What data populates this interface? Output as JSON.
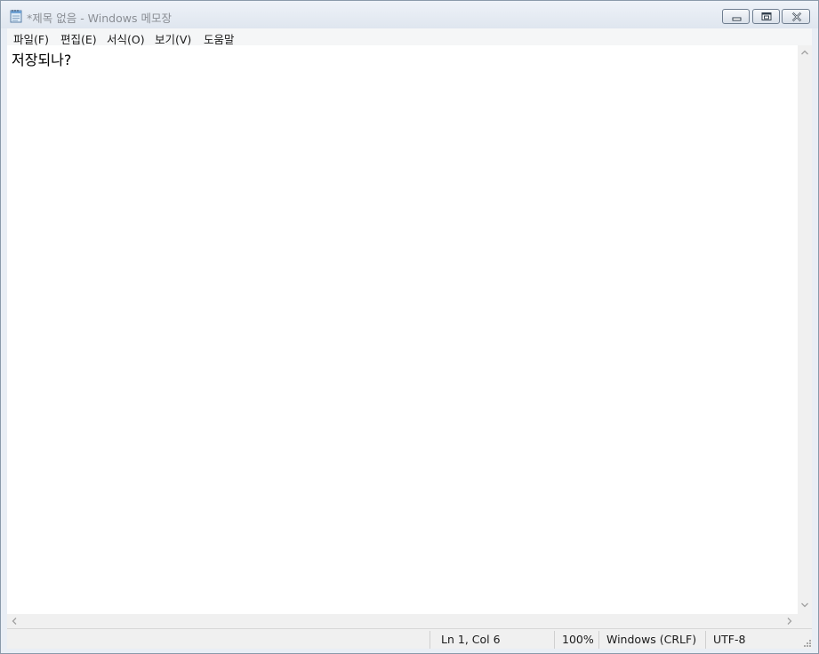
{
  "window": {
    "title": "*제목 없음 - Windows 메모장",
    "icon": "notepad-icon",
    "controls": {
      "minimize_icon": "minimize-icon",
      "maximize_icon": "maximize-icon",
      "close_icon": "close-icon"
    }
  },
  "menubar": {
    "items": [
      {
        "label": "파일(F)"
      },
      {
        "label": "편집(E)"
      },
      {
        "label": "서식(O)"
      },
      {
        "label": "보기(V)"
      },
      {
        "label": "도움말"
      }
    ]
  },
  "editor": {
    "content": "저장되나?"
  },
  "statusbar": {
    "position": "Ln 1, Col 6",
    "zoom": "100%",
    "line_ending": "Windows (CRLF)",
    "encoding": "UTF-8"
  },
  "colors": {
    "title_text": "#8a8e94",
    "close_accent": "#c0392b"
  }
}
